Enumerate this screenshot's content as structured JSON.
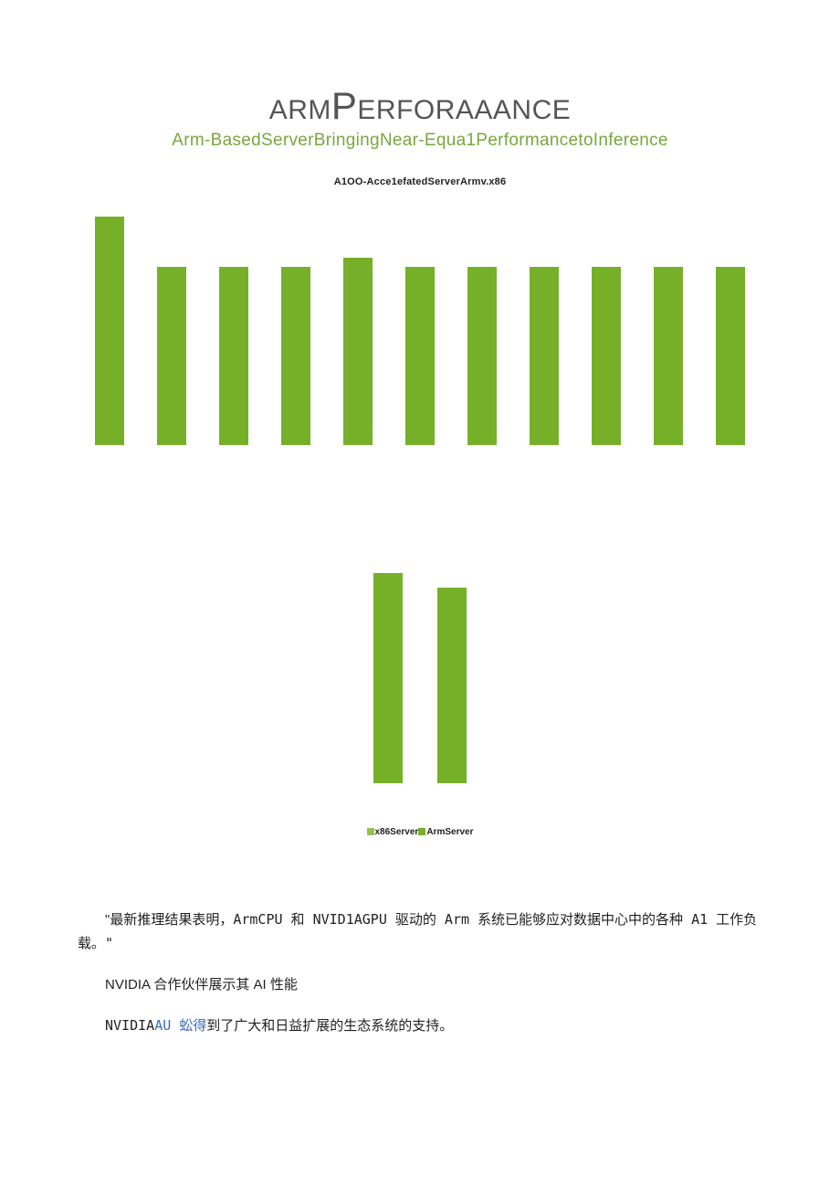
{
  "heading": {
    "pre": "ARM",
    "bigP": "P",
    "rest": "ERFORAAANCE"
  },
  "subtitle": "Arm-BasedServerBringingNear-Equa1PerformancetoInference",
  "chart_label": "A1OO-Acce1efatedServerArmv.x86",
  "legend": {
    "a": "x86Server",
    "b": "ArmServer"
  },
  "paragraphs": {
    "p1_a": "\"最新推理结果表明，",
    "p1_b": "ArmCPU 和 NVID1AGPU 驱动的 Arm 系统已能够应对数据中心中的各种 A1 工作负载。\"",
    "p2": "NVIDIA 合作伙伴展示其 AI 性能",
    "p3_a": "NVIDIA",
    "p3_link": "AU 蚣得",
    "p3_b": "到了广大和日益扩展的生态系统的支持。"
  },
  "chart_data": [
    {
      "type": "bar",
      "title": "A1OO-Acce1efatedServerArmv.x86",
      "categories": [
        "",
        "",
        "",
        "",
        "",
        "",
        "",
        "",
        "",
        "",
        ""
      ],
      "values": [
        1.0,
        0.78,
        0.78,
        0.78,
        0.82,
        0.78,
        0.78,
        0.78,
        0.78,
        0.78,
        0.78
      ],
      "ylabel": "",
      "ylim": [
        0,
        1.0
      ]
    },
    {
      "type": "bar",
      "title": "",
      "series": [
        {
          "name": "x86Server",
          "values": [
            1.0
          ]
        },
        {
          "name": "ArmServer",
          "values": [
            0.93
          ]
        }
      ],
      "categories": [
        ""
      ],
      "ylim": [
        0,
        1.0
      ]
    }
  ]
}
